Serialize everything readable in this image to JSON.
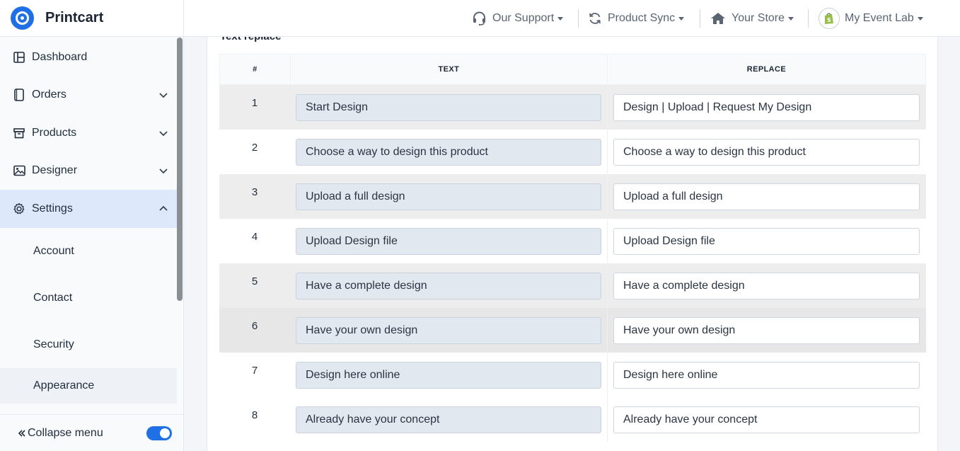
{
  "brand": {
    "name": "Printcart"
  },
  "sidebar": {
    "items": [
      {
        "label": "Dashboard",
        "icon": "dashboard-icon",
        "expandable": false
      },
      {
        "label": "Orders",
        "icon": "orders-icon",
        "expandable": true
      },
      {
        "label": "Products",
        "icon": "products-icon",
        "expandable": true
      },
      {
        "label": "Designer",
        "icon": "image-icon",
        "expandable": true
      },
      {
        "label": "Settings",
        "icon": "gear-icon",
        "expandable": true,
        "expanded": true
      }
    ],
    "subitems": [
      {
        "label": "Account"
      },
      {
        "label": "Contact"
      },
      {
        "label": "Security"
      },
      {
        "label": "Appearance"
      }
    ],
    "collapse_label": "Collapse menu",
    "collapse_toggle_on": true
  },
  "topbar": {
    "support": "Our Support",
    "sync": "Product Sync",
    "store": "Your Store",
    "account": "My Event Lab"
  },
  "main": {
    "section_title": "Text replace",
    "columns": {
      "num": "#",
      "text": "TEXT",
      "replace": "REPLACE"
    },
    "rows": [
      {
        "num": "1",
        "text": "Start Design",
        "replace": "Design | Upload | Request My Design"
      },
      {
        "num": "2",
        "text": "Choose a way to design this product",
        "replace": "Choose a way to design this product"
      },
      {
        "num": "3",
        "text": "Upload a full design",
        "replace": "Upload a full design"
      },
      {
        "num": "4",
        "text": "Upload Design file",
        "replace": "Upload Design file"
      },
      {
        "num": "5",
        "text": "Have a complete design",
        "replace": "Have a complete design"
      },
      {
        "num": "6",
        "text": "Have your own design",
        "replace": "Have your own design"
      },
      {
        "num": "7",
        "text": "Design here online",
        "replace": "Design here online"
      },
      {
        "num": "8",
        "text": "Already have your concept",
        "replace": "Already have your concept"
      }
    ]
  },
  "colors": {
    "accent": "#1f6fe5",
    "active_bg": "#dde9fb",
    "shopify_green": "#95bf47"
  }
}
